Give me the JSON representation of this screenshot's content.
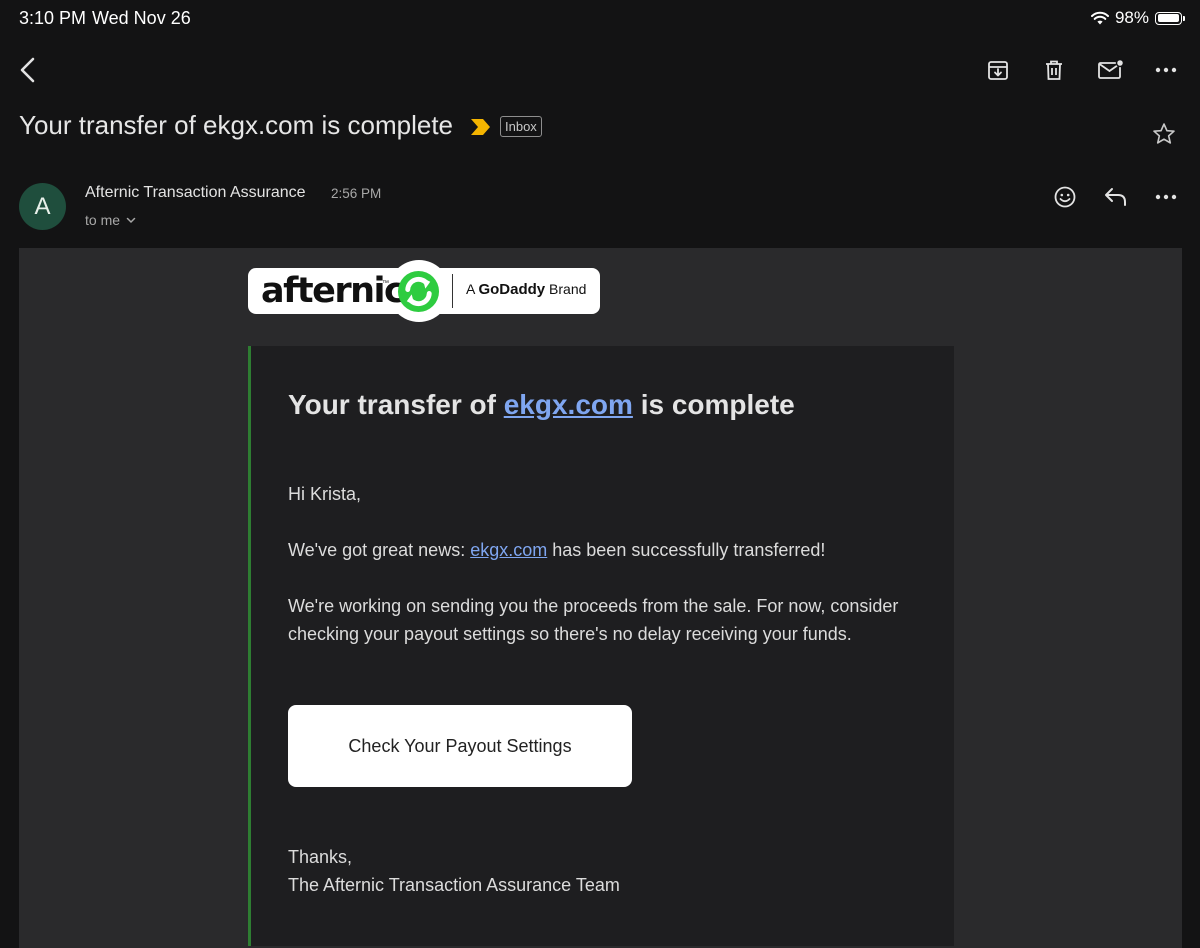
{
  "status_bar": {
    "time": "3:10 PM",
    "date": "Wed Nov 26",
    "battery": "98%",
    "battery_level": 0.98
  },
  "toolbar": {
    "icons": [
      "back-icon",
      "archive-icon",
      "trash-icon",
      "mark-unread-icon",
      "more-icon"
    ]
  },
  "message": {
    "subject": "Your transfer of ekgx.com is complete",
    "label": "Inbox",
    "sender": "Afternic Transaction Assurance",
    "time": "2:56 PM",
    "recipient": "to me",
    "avatar_letter": "A"
  },
  "email": {
    "logo_word": "afternic",
    "logo_tm": "™",
    "brand_prefix": "A",
    "brand_name": "GoDaddy",
    "brand_suffix": "Brand",
    "headline_before": "Your transfer of",
    "headline_domain": "ekgx.com",
    "headline_after": "is complete",
    "greeting": "Hi Krista,",
    "para1_before": "We've got great news:",
    "para1_domain": "ekgx.com",
    "para1_after": "has been successfully transferred!",
    "para2": "We're working on sending you the proceeds from the sale. For now, consider checking your payout settings so there's no delay receiving your funds.",
    "cta": "Check Your Payout Settings",
    "thanks": "Thanks,",
    "signature": "The Afternic Transaction Assurance Team"
  },
  "colors": {
    "background": "#131314",
    "link": "#7fa6f0",
    "brand_green": "#2ecc40",
    "accent_border": "#2e7d32",
    "importance": "#f4b400"
  }
}
